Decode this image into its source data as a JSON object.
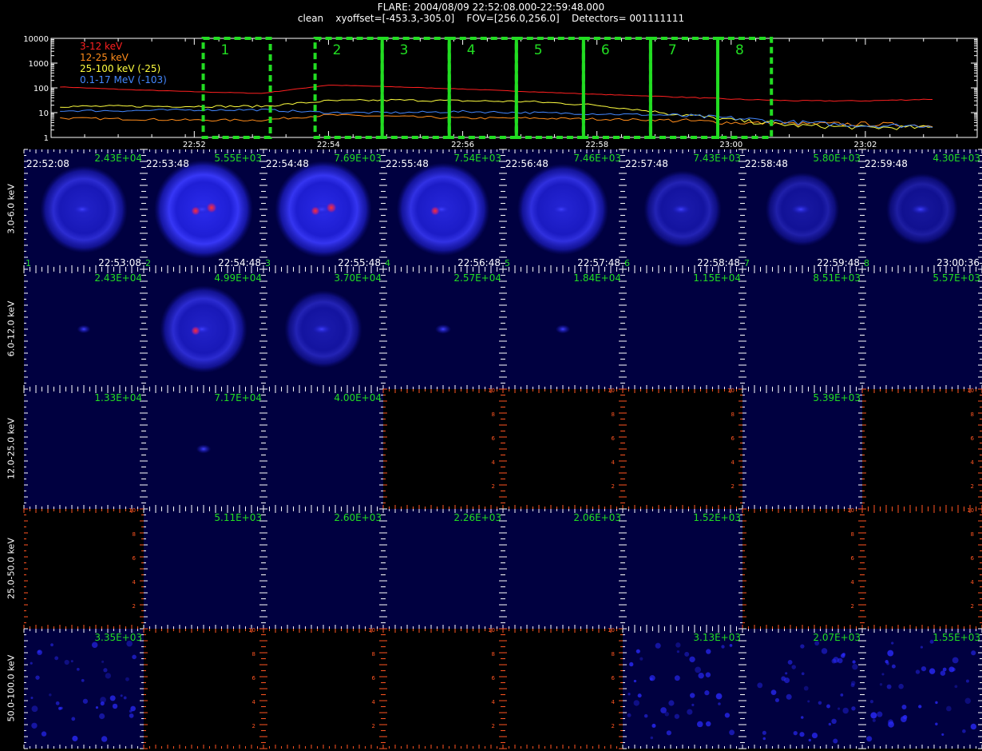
{
  "header": {
    "line1": "FLARE: 2004/08/09 22:52:08.000-22:59:48.000",
    "line2": "clean    xyoffset=[-453.3,-305.0]    FOV=[256.0,256.0]    Detectors= 001111111"
  },
  "colors": {
    "background": "#000000",
    "axis": "#ffffff",
    "interval_box": "#22dd22",
    "empty_axis": "#ff5522",
    "label_green": "#22dd22",
    "image_blue": "#1a1aff"
  },
  "chart_data": [
    {
      "type": "line",
      "yscale": "log",
      "ylim": [
        1,
        10000
      ],
      "ytick_labels": [
        "1",
        "10",
        "100",
        "1000",
        "10000"
      ],
      "xtick_labels": [
        "22:52",
        "22:54",
        "22:56",
        "22:58",
        "23:00",
        "23:02"
      ],
      "legend_position": "top-left",
      "x": [
        "22:50",
        "22:51",
        "22:52",
        "22:53",
        "22:54",
        "22:55",
        "22:56",
        "22:57",
        "22:58",
        "22:59",
        "23:00",
        "23:01",
        "23:02",
        "23:03"
      ],
      "series": [
        {
          "name": "3-12 keV",
          "color": "#ff2020",
          "values": [
            110,
            85,
            70,
            60,
            130,
            110,
            90,
            70,
            55,
            45,
            35,
            30,
            30,
            35
          ]
        },
        {
          "name": "12-25 keV",
          "color": "#ff8c1a",
          "values": [
            6,
            5.5,
            5,
            5,
            8,
            7,
            6,
            6,
            5.5,
            5,
            4,
            3.5,
            3.5,
            3
          ]
        },
        {
          "name": "25-100 keV (-25)",
          "color": "#ffff40",
          "values": [
            18,
            18,
            18,
            18,
            30,
            32,
            30,
            28,
            20,
            10,
            5,
            3,
            2.5,
            2.5
          ]
        },
        {
          "name": "0.1-17 MeV (-103)",
          "color": "#4488ff",
          "values": [
            12,
            12,
            13,
            13,
            10,
            10,
            11,
            10,
            9,
            8,
            6,
            4,
            3,
            3
          ]
        }
      ],
      "intervals": [
        {
          "label": "1",
          "start": "22:52:08",
          "end": "22:53:08"
        },
        {
          "label": "2",
          "start": "22:53:48",
          "end": "22:54:48"
        },
        {
          "label": "3",
          "start": "22:54:48",
          "end": "22:55:48"
        },
        {
          "label": "4",
          "start": "22:55:48",
          "end": "22:56:48"
        },
        {
          "label": "5",
          "start": "22:56:48",
          "end": "22:57:48"
        },
        {
          "label": "6",
          "start": "22:57:48",
          "end": "22:58:48"
        },
        {
          "label": "7",
          "start": "22:58:48",
          "end": "22:59:48"
        },
        {
          "label": "8",
          "start": "22:59:48",
          "end": "23:00:36"
        }
      ]
    },
    {
      "type": "heatmap",
      "energy_bands": [
        "3.0-6.0 keV",
        "6.0-12.0 keV",
        "12.0-25.0 keV",
        "25.0-50.0 keV",
        "50.0-100.0 keV"
      ],
      "start_times": [
        "22:52:08",
        "22:53:48",
        "22:54:48",
        "22:55:48",
        "22:56:48",
        "22:57:48",
        "22:58:48",
        "22:59:48"
      ],
      "end_times": [
        "22:53:08",
        "22:54:48",
        "22:55:48",
        "22:56:48",
        "22:57:48",
        "22:58:48",
        "22:59:48",
        "23:00:36"
      ],
      "interval_numbers": [
        "1",
        "2",
        "3",
        "4",
        "5",
        "6",
        "7",
        "8"
      ],
      "empty_axis_ticks": [
        "2",
        "4",
        "6",
        "8",
        "10"
      ],
      "cells": [
        [
          {
            "max": "2.43E+04",
            "kind": "ring",
            "level": 0.7,
            "hot": 0
          },
          {
            "max": "5.55E+03",
            "kind": "ring",
            "level": 1.0,
            "hot": 2
          },
          {
            "max": "7.69E+03",
            "kind": "ring",
            "level": 0.95,
            "hot": 2
          },
          {
            "max": "7.54E+03",
            "kind": "ring",
            "level": 0.85,
            "hot": 1
          },
          {
            "max": "7.46E+03",
            "kind": "ring",
            "level": 0.8,
            "hot": 0
          },
          {
            "max": "7.43E+03",
            "kind": "ring",
            "level": 0.45,
            "hot": 0
          },
          {
            "max": "5.80E+03",
            "kind": "ring",
            "level": 0.35,
            "hot": 0
          },
          {
            "max": "4.30E+03",
            "kind": "ring",
            "level": 0.3,
            "hot": 0
          }
        ],
        [
          {
            "max": "2.43E+04",
            "kind": "dot",
            "level": 0.3,
            "hot": 0
          },
          {
            "max": "4.99E+04",
            "kind": "ring",
            "level": 0.7,
            "hot": 1
          },
          {
            "max": "3.70E+04",
            "kind": "ring",
            "level": 0.45,
            "hot": 0
          },
          {
            "max": "2.57E+04",
            "kind": "dot",
            "level": 0.5,
            "hot": 0
          },
          {
            "max": "1.84E+04",
            "kind": "dot",
            "level": 0.4,
            "hot": 0
          },
          {
            "max": "1.15E+04",
            "kind": "flat",
            "level": 0.1,
            "hot": 0
          },
          {
            "max": "8.51E+03",
            "kind": "flat",
            "level": 0.1,
            "hot": 0
          },
          {
            "max": "5.57E+03",
            "kind": "flat",
            "level": 0.1,
            "hot": 0
          }
        ],
        [
          {
            "max": "1.33E+04",
            "kind": "flat",
            "level": 0.1,
            "hot": 0
          },
          {
            "max": "7.17E+04",
            "kind": "dot",
            "level": 0.4,
            "hot": 0
          },
          {
            "max": "4.00E+04",
            "kind": "flat",
            "level": 0.1,
            "hot": 0
          },
          {
            "max": "",
            "kind": "empty"
          },
          {
            "max": "",
            "kind": "empty"
          },
          {
            "max": "",
            "kind": "empty"
          },
          {
            "max": "5.39E+03",
            "kind": "flat",
            "level": 0.1,
            "hot": 0
          },
          {
            "max": "",
            "kind": "empty"
          }
        ],
        [
          {
            "max": "",
            "kind": "empty"
          },
          {
            "max": "5.11E+03",
            "kind": "flat",
            "level": 0.1,
            "hot": 0
          },
          {
            "max": "2.60E+03",
            "kind": "flat",
            "level": 0.1,
            "hot": 0
          },
          {
            "max": "2.26E+03",
            "kind": "flat",
            "level": 0.1,
            "hot": 0
          },
          {
            "max": "2.06E+03",
            "kind": "flat",
            "level": 0.1,
            "hot": 0
          },
          {
            "max": "1.52E+03",
            "kind": "flat",
            "level": 0.1,
            "hot": 0
          },
          {
            "max": "",
            "kind": "empty"
          },
          {
            "max": "",
            "kind": "empty"
          }
        ],
        [
          {
            "max": "3.35E+03",
            "kind": "noise",
            "level": 0.3,
            "hot": 0
          },
          {
            "max": "",
            "kind": "empty"
          },
          {
            "max": "",
            "kind": "empty"
          },
          {
            "max": "",
            "kind": "empty"
          },
          {
            "max": "",
            "kind": "empty"
          },
          {
            "max": "3.13E+03",
            "kind": "noise",
            "level": 0.3,
            "hot": 0
          },
          {
            "max": "2.07E+03",
            "kind": "noise",
            "level": 0.3,
            "hot": 0
          },
          {
            "max": "1.55E+03",
            "kind": "noise",
            "level": 0.3,
            "hot": 0
          }
        ]
      ]
    }
  ]
}
